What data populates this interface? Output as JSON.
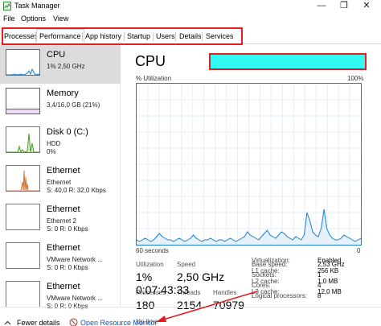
{
  "window": {
    "title": "Task Manager",
    "minimize": "—",
    "restore": "❐",
    "close": "✕"
  },
  "menu": {
    "items": [
      "File",
      "Options",
      "View"
    ]
  },
  "tabs": [
    "Processes",
    "Performance",
    "App history",
    "Startup",
    "Users",
    "Details",
    "Services"
  ],
  "sidebar": {
    "items": [
      {
        "title": "CPU",
        "lines": [
          "1% 2,50 GHz"
        ]
      },
      {
        "title": "Memory",
        "lines": [
          "3,4/16,0 GB (21%)"
        ]
      },
      {
        "title": "Disk 0 (C:)",
        "lines": [
          "HDD",
          "0%"
        ]
      },
      {
        "title": "Ethernet",
        "lines": [
          "Ethernet",
          "S: 40,0 R: 32,0 Kbps"
        ]
      },
      {
        "title": "Ethernet",
        "lines": [
          "Ethernet 2",
          "S: 0 R: 0 Kbps"
        ]
      },
      {
        "title": "Ethernet",
        "lines": [
          "VMware Network ...",
          "S: 0 R: 0 Kbps"
        ]
      },
      {
        "title": "Ethernet",
        "lines": [
          "VMware Network ...",
          "S: 0 R: 0 Kbps"
        ]
      }
    ]
  },
  "main": {
    "title": "CPU",
    "graph": {
      "y_label": "% Utilization",
      "y_max_label": "100%",
      "x_label": "60 seconds",
      "y_min_label": "0",
      "utilization_percent": [
        3,
        2,
        3,
        4,
        3,
        2,
        3,
        5,
        7,
        5,
        4,
        3,
        3,
        2,
        3,
        4,
        3,
        2,
        3,
        4,
        6,
        4,
        3,
        2,
        3,
        3,
        4,
        3,
        2,
        3,
        3,
        2,
        3,
        4,
        3,
        2,
        3,
        4,
        5,
        8,
        6,
        5,
        4,
        3,
        5,
        7,
        9,
        6,
        5,
        4,
        6,
        8,
        7,
        5,
        4,
        3,
        5,
        4,
        3,
        6,
        20,
        15,
        8,
        6,
        5,
        10,
        22,
        10,
        6,
        4,
        3,
        3,
        4,
        6,
        5,
        4,
        3,
        2,
        3,
        4
      ]
    },
    "stats": {
      "utilization_label": "Utilization",
      "utilization": "1%",
      "speed_label": "Speed",
      "speed": "2,50 GHz",
      "processes_label": "Processes",
      "processes": "180",
      "threads_label": "Threads",
      "threads": "2154",
      "handles_label": "Handles",
      "handles": "70979",
      "uptime_label": "Up time",
      "uptime": "0:07:43:33"
    },
    "details": [
      {
        "key": "Base speed:",
        "value": "2,53 GHz"
      },
      {
        "key": "Sockets:",
        "value": "1"
      },
      {
        "key": "Cores:",
        "value": "4"
      },
      {
        "key": "Logical processors:",
        "value": "8"
      },
      {
        "key": "Virtualization:",
        "value": "Enabled"
      },
      {
        "key": "L1 cache:",
        "value": "256 KB"
      },
      {
        "key": "L2 cache:",
        "value": "1,0 MB"
      },
      {
        "key": "L3 cache:",
        "value": "12,0 MB"
      }
    ]
  },
  "footer": {
    "fewer_details": "Fewer details",
    "open_monitor": "Open Resource Monitor"
  },
  "colors": {
    "cpu": "#1a7fd1",
    "memory": "#a12cb8",
    "disk": "#4a9a22",
    "ethernet": "#c85a1a",
    "highlight": "#e02020",
    "redacted": "#33f8f4"
  }
}
